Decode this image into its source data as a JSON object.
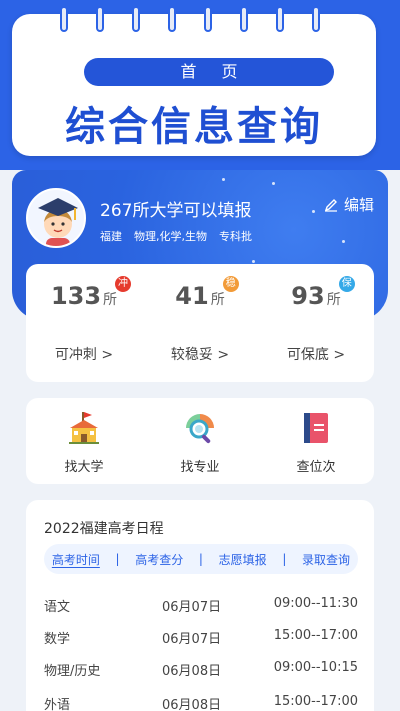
{
  "header": {
    "nav_label": "首 页",
    "title": "综合信息查询"
  },
  "profile": {
    "title": "267所大学可以填报",
    "tags": [
      "福建",
      "物理,化学,生物",
      "专科批"
    ],
    "edit_label": "编辑"
  },
  "stats": [
    {
      "count": "133",
      "unit": "所",
      "badge": "冲",
      "badge_color": "#e63b2e",
      "link": "可冲刺 >"
    },
    {
      "count": "41",
      "unit": "所",
      "badge": "稳",
      "badge_color": "#f29b38",
      "link": "较稳妥 >"
    },
    {
      "count": "93",
      "unit": "所",
      "badge": "保",
      "badge_color": "#35a9e8",
      "link": "可保底 >"
    }
  ],
  "tools": [
    {
      "label": "找大学",
      "icon": "university-icon"
    },
    {
      "label": "找专业",
      "icon": "major-search-icon"
    },
    {
      "label": "查位次",
      "icon": "rank-book-icon"
    }
  ],
  "schedule": {
    "title": "2022福建高考日程",
    "tabs": [
      "高考时间",
      "高考查分",
      "志愿填报",
      "录取查询"
    ],
    "separator": "|",
    "rows": [
      {
        "subject": "语文",
        "date": "06月07日",
        "time": "09:00--11:30"
      },
      {
        "subject": "数学",
        "date": "06月07日",
        "time": "15:00--17:00"
      },
      {
        "subject": "物理/历史",
        "date": "06月08日",
        "time": "09:00--10:15"
      },
      {
        "subject": "外语",
        "date": "06月08日",
        "time": "15:00--17:00"
      }
    ]
  },
  "colors": {
    "primary": "#2c63e6",
    "title_blue": "#1f4fd2"
  }
}
